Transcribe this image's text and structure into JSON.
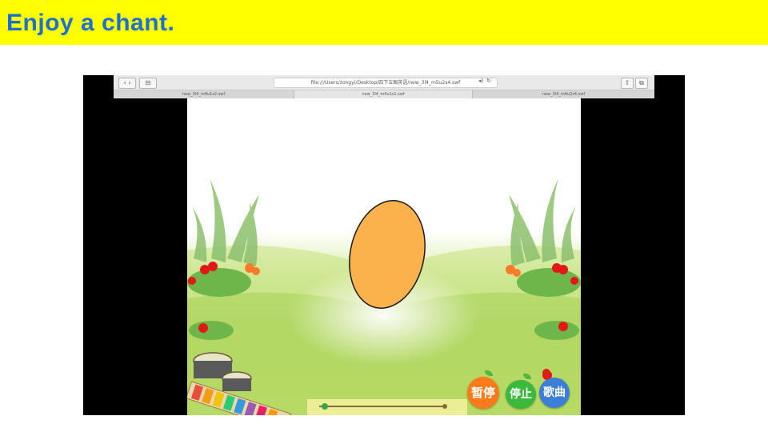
{
  "slide": {
    "title": "Enjoy a chant."
  },
  "browser": {
    "url": "file:///Users/zongyi/Desktop/四下五图英语/new_3l4_m5u2s4.swf",
    "tabs": [
      {
        "label": "new_3l4_m4u1s2.swf"
      },
      {
        "label": "new_3l4_m4u1s1.swf"
      },
      {
        "label": "new_3l4_m4u2s4.swf"
      }
    ]
  },
  "player": {
    "buttons": {
      "pause": "暂停",
      "stop": "停止",
      "song": "歌曲"
    },
    "progress": 0.0
  },
  "colors": {
    "title_bar": "#ffff00",
    "title_text": "#1d6fd1",
    "egg": "#fbb24d",
    "pause": "#ff7a1a",
    "stop": "#3cb93c",
    "song": "#3b7fd6"
  }
}
